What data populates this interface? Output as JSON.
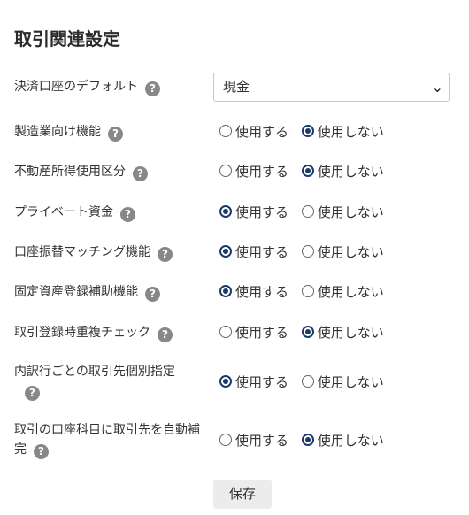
{
  "page_title": "取引関連設定",
  "help_glyph": "?",
  "option_labels": {
    "use": "使用する",
    "no_use": "使用しない"
  },
  "default_account": {
    "label": "決済口座のデフォルト",
    "selected": "現金"
  },
  "settings": [
    {
      "label": "製造業向け機能",
      "selected": "no_use"
    },
    {
      "label": "不動産所得使用区分",
      "selected": "no_use"
    },
    {
      "label": "プライベート資金",
      "selected": "use"
    },
    {
      "label": "口座振替マッチング機能",
      "selected": "use"
    },
    {
      "label": "固定資産登録補助機能",
      "selected": "use"
    },
    {
      "label": "取引登録時重複チェック",
      "selected": "no_use"
    },
    {
      "label_line1": "内訳行ごとの取引先個別指定",
      "label_line2": "",
      "selected": "use"
    },
    {
      "label_line1": "取引の口座科目に取引先を自動補",
      "label_line2": "完",
      "selected": "no_use"
    }
  ],
  "save_label": "保存",
  "colors": {
    "radio_selected": "#1b3a6b",
    "help_icon": "#888888"
  }
}
